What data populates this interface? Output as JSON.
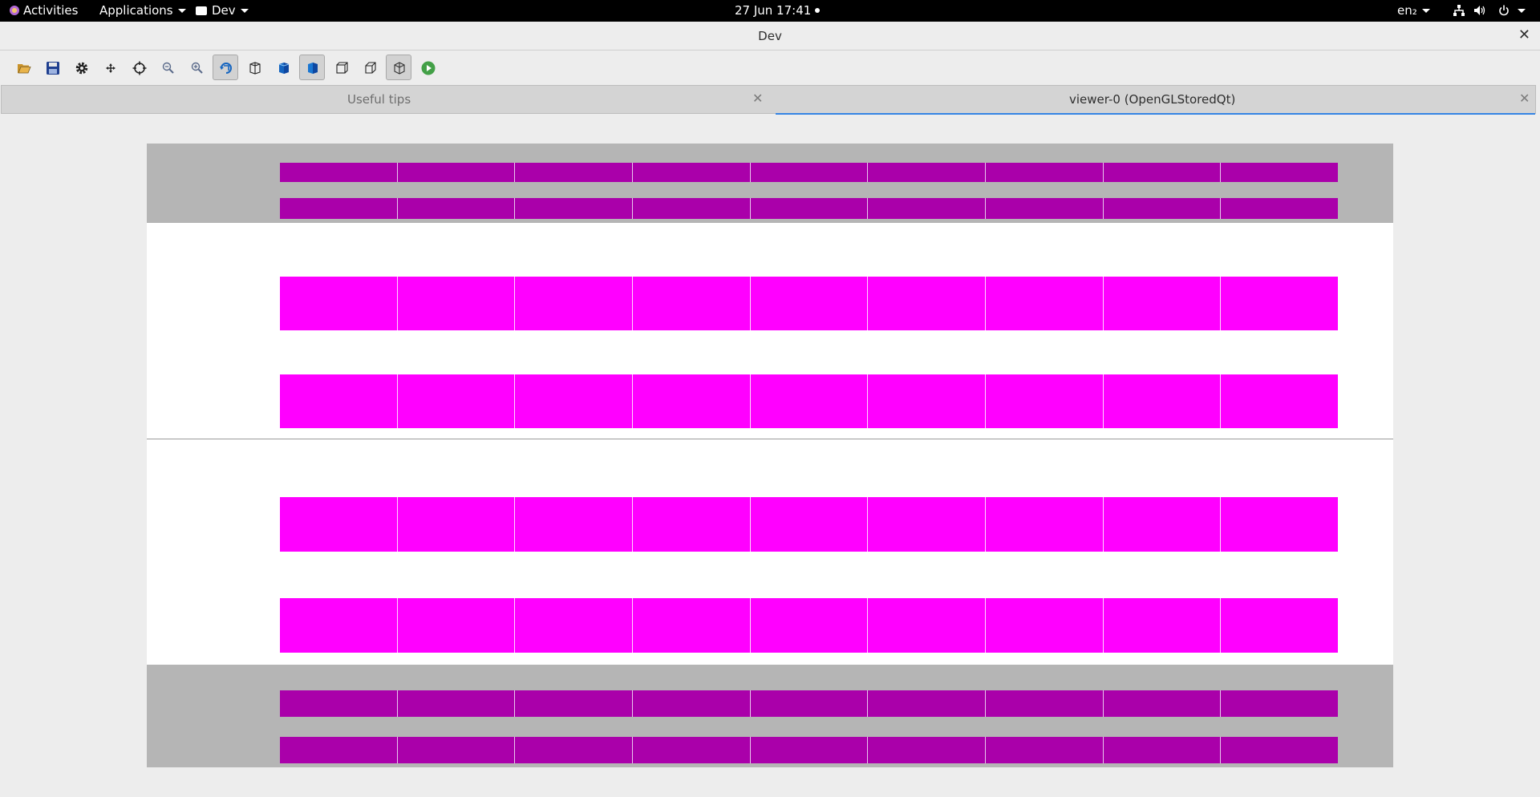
{
  "topbar": {
    "activities": "Activities",
    "applications": "Applications",
    "app_menu": "Dev",
    "datetime": "27 Jun  17:41",
    "keyboard_layout": "en₂"
  },
  "window": {
    "title": "Dev",
    "close_glyph": "✕"
  },
  "toolbar": {
    "buttons": [
      {
        "name": "open-icon",
        "active": false
      },
      {
        "name": "save-icon",
        "active": false
      },
      {
        "name": "settings-gear-icon",
        "active": false
      },
      {
        "name": "move-arrows-icon",
        "active": false
      },
      {
        "name": "crosshair-icon",
        "active": false
      },
      {
        "name": "zoom-out-icon",
        "active": false
      },
      {
        "name": "zoom-in-icon",
        "active": false
      },
      {
        "name": "rotate-view-icon",
        "active": true
      },
      {
        "name": "wireframe-cube-icon",
        "active": false
      },
      {
        "name": "shaded-cube-icon",
        "active": false
      },
      {
        "name": "solid-cube-icon",
        "active": true
      },
      {
        "name": "front-view-icon",
        "active": false
      },
      {
        "name": "side-view-icon",
        "active": false
      },
      {
        "name": "iso-view-icon",
        "active": true
      },
      {
        "name": "run-play-icon",
        "active": false
      }
    ],
    "colors": {
      "accent_blue": "#1565c0",
      "play_green": "#43a047"
    }
  },
  "tabs": [
    {
      "label": "Useful tips",
      "active": false,
      "close_glyph": "✕"
    },
    {
      "label": "viewer-0 (OpenGLStoredQt)",
      "active": true,
      "close_glyph": "✕"
    }
  ],
  "viewer": {
    "background": "#ffffff",
    "colors": {
      "band_gray": "#b5b5b5",
      "dark_magenta": "#aa00aa",
      "magenta": "#ff00ff"
    },
    "segments_per_row": 9
  }
}
